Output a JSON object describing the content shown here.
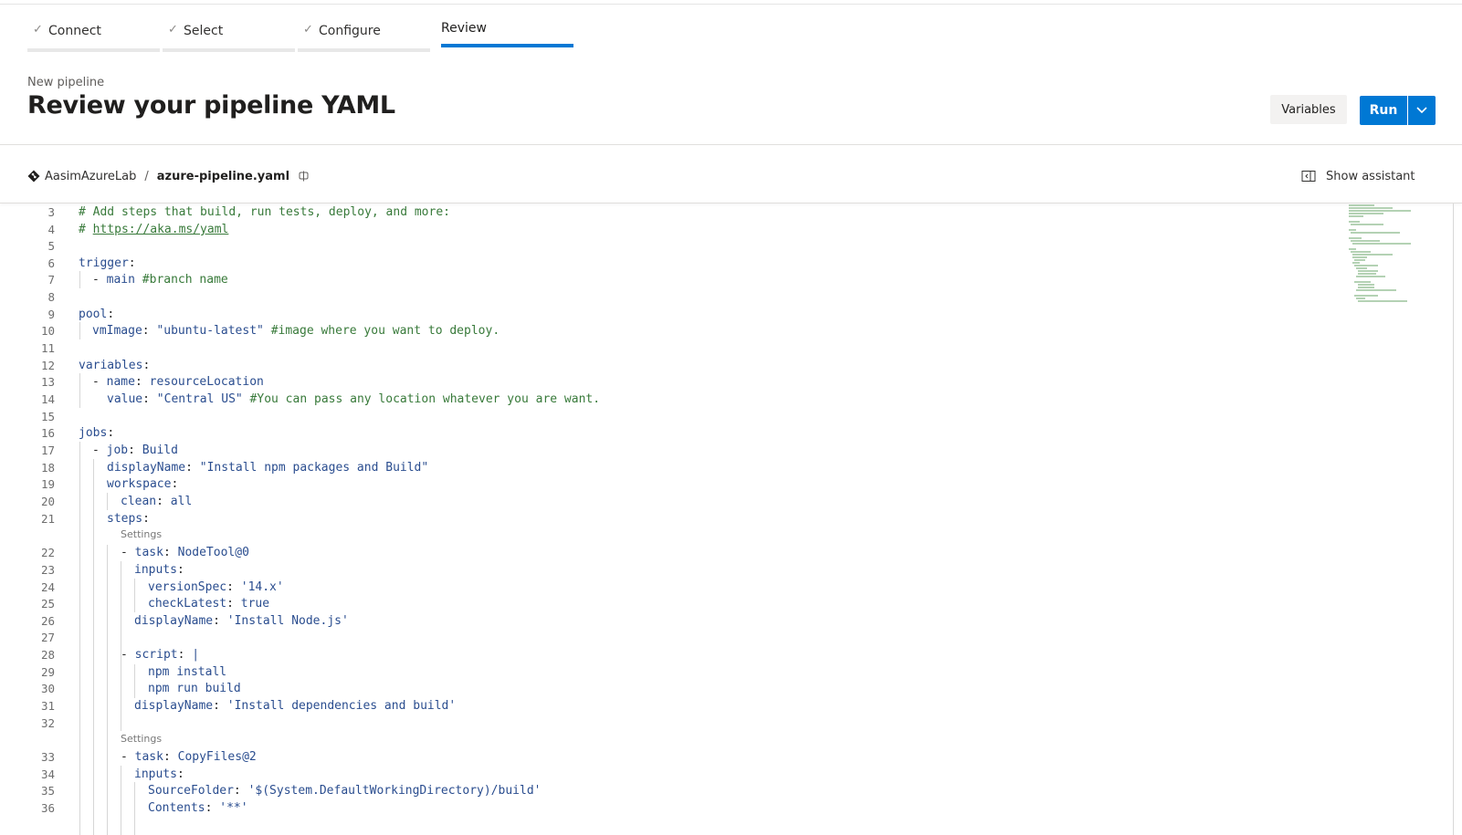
{
  "wizard": {
    "steps": [
      {
        "label": "Connect",
        "done": true
      },
      {
        "label": "Select",
        "done": true
      },
      {
        "label": "Configure",
        "done": true
      },
      {
        "label": "Review",
        "done": false,
        "active": true
      }
    ]
  },
  "header": {
    "subtitle": "New pipeline",
    "title": "Review your pipeline YAML",
    "variables_label": "Variables",
    "run_label": "Run"
  },
  "breadcrumb": {
    "repo": "AasimAzureLab",
    "separator": "/",
    "file": "azure-pipeline.yaml"
  },
  "assistant": {
    "label": "Show assistant"
  },
  "editor": {
    "settings_label": "Settings",
    "lines": {
      "l3": {
        "num": "3",
        "text": "# Add steps that build, run tests, deploy, and more:"
      },
      "l4": {
        "num": "4",
        "prefix": "# ",
        "link": "https://aka.ms/yaml"
      },
      "l5": {
        "num": "5"
      },
      "l6": {
        "num": "6",
        "key": "trigger",
        "p": ":"
      },
      "l7": {
        "num": "7",
        "dash": "- ",
        "val": "main ",
        "comment": "#branch name"
      },
      "l8": {
        "num": "8"
      },
      "l9": {
        "num": "9",
        "key": "pool",
        "p": ":"
      },
      "l10": {
        "num": "10",
        "key": "vmImage",
        "p": ": ",
        "val": "\"ubuntu-latest\" ",
        "comment": "#image where you want to deploy."
      },
      "l11": {
        "num": "11"
      },
      "l12": {
        "num": "12",
        "key": "variables",
        "p": ":"
      },
      "l13": {
        "num": "13",
        "dash": "- ",
        "key": "name",
        "p": ": ",
        "val": "resourceLocation"
      },
      "l14": {
        "num": "14",
        "key": "value",
        "p": ": ",
        "val": "\"Central US\" ",
        "comment": "#You can pass any location whatever you are want."
      },
      "l15": {
        "num": "15"
      },
      "l16": {
        "num": "16",
        "key": "jobs",
        "p": ":"
      },
      "l17": {
        "num": "17",
        "dash": "- ",
        "key": "job",
        "p": ": ",
        "val": "Build"
      },
      "l18": {
        "num": "18",
        "key": "displayName",
        "p": ": ",
        "val": "\"Install npm packages and Build\""
      },
      "l19": {
        "num": "19",
        "key": "workspace",
        "p": ":"
      },
      "l20": {
        "num": "20",
        "key": "clean",
        "p": ": ",
        "val": "all"
      },
      "l21": {
        "num": "21",
        "key": "steps",
        "p": ":"
      },
      "l22": {
        "num": "22",
        "dash": "- ",
        "key": "task",
        "p": ": ",
        "val": "NodeTool@0"
      },
      "l23": {
        "num": "23",
        "key": "inputs",
        "p": ":"
      },
      "l24": {
        "num": "24",
        "key": "versionSpec",
        "p": ": ",
        "val": "'14.x'"
      },
      "l25": {
        "num": "25",
        "key": "checkLatest",
        "p": ": ",
        "val": "true"
      },
      "l26": {
        "num": "26",
        "key": "displayName",
        "p": ": ",
        "val": "'Install Node.js'"
      },
      "l27": {
        "num": "27"
      },
      "l28": {
        "num": "28",
        "dash": "- ",
        "key": "script",
        "p": ": ",
        "val": "|"
      },
      "l29": {
        "num": "29",
        "val": "npm install"
      },
      "l30": {
        "num": "30",
        "val": "npm run build"
      },
      "l31": {
        "num": "31",
        "key": "displayName",
        "p": ": ",
        "val": "'Install dependencies and build'"
      },
      "l32": {
        "num": "32"
      },
      "l33": {
        "num": "33",
        "dash": "- ",
        "key": "task",
        "p": ": ",
        "val": "CopyFiles@2"
      },
      "l34": {
        "num": "34",
        "key": "inputs",
        "p": ":"
      },
      "l35": {
        "num": "35",
        "key": "SourceFolder",
        "p": ": ",
        "val": "'$(System.DefaultWorkingDirectory)/build'"
      },
      "l36": {
        "num": "36",
        "key": "Contents",
        "p": ": ",
        "val": "'**'"
      }
    }
  }
}
